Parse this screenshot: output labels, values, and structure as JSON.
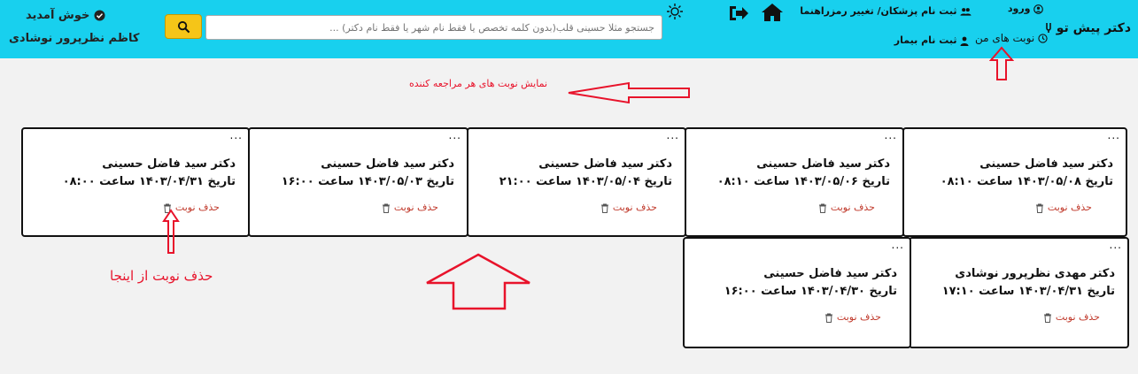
{
  "header": {
    "brand": "دکتر پیش تو",
    "login": "ورود",
    "my_appointments": "نوبت های من",
    "register_doctors": "ثبت نام پزشکان/ تغییر رمز",
    "register_patient": "ثبت نام بیمار",
    "guide": "راهنما",
    "welcome": "خوش آمدید",
    "user_name": "کاظم نظرپرور نوشادی"
  },
  "search": {
    "placeholder": "جستجو مثلا حسینی قلب(بدون کلمه تخصص یا فقط نام شهر یا فقط نام دکتر) ..."
  },
  "appointments": [
    {
      "doctor": "دکتر سید فاضل حسینی",
      "when": "تاریخ ۱۴۰۳/۰۵/۰۸ ساعت ۰۸:۱۰",
      "delete": "حذف نوبت",
      "menu": "..."
    },
    {
      "doctor": "دکتر سید فاضل حسینی",
      "when": "تاریخ ۱۴۰۳/۰۵/۰۶ ساعت ۰۸:۱۰",
      "delete": "حذف نوبت",
      "menu": "..."
    },
    {
      "doctor": "دکتر سید فاضل حسینی",
      "when": "تاریخ ۱۴۰۳/۰۵/۰۴ ساعت ۲۱:۰۰",
      "delete": "حذف نوبت",
      "menu": "..."
    },
    {
      "doctor": "دکتر سید فاضل حسینی",
      "when": "تاریخ ۱۴۰۳/۰۵/۰۳ ساعت ۱۶:۰۰",
      "delete": "حذف نوبت",
      "menu": "..."
    },
    {
      "doctor": "دکتر سید فاضل حسینی",
      "when": "تاریخ ۱۴۰۳/۰۴/۳۱ ساعت ۰۸:۰۰",
      "delete": "حذف نوبت",
      "menu": "..."
    },
    {
      "doctor": "دکتر مهدی نظرپرور نوشادی",
      "when": "تاریخ ۱۴۰۳/۰۴/۳۱ ساعت ۱۷:۱۰",
      "delete": "حذف نوبت",
      "menu": "..."
    },
    {
      "doctor": "دکتر سید فاضل حسینی",
      "when": "تاریخ ۱۴۰۳/۰۴/۳۰ ساعت ۱۶:۰۰",
      "delete": "حذف نوبت",
      "menu": "..."
    }
  ],
  "annotations": {
    "show_appointments": "نمایش نوبت های هر مراجعه کننده",
    "delete_here": "حذف نوبت از اینجا"
  },
  "colors": {
    "header_bg": "#18d0ee",
    "accent_button": "#f5c518",
    "annotation": "#e8132b",
    "delete_link": "#c0392b"
  }
}
